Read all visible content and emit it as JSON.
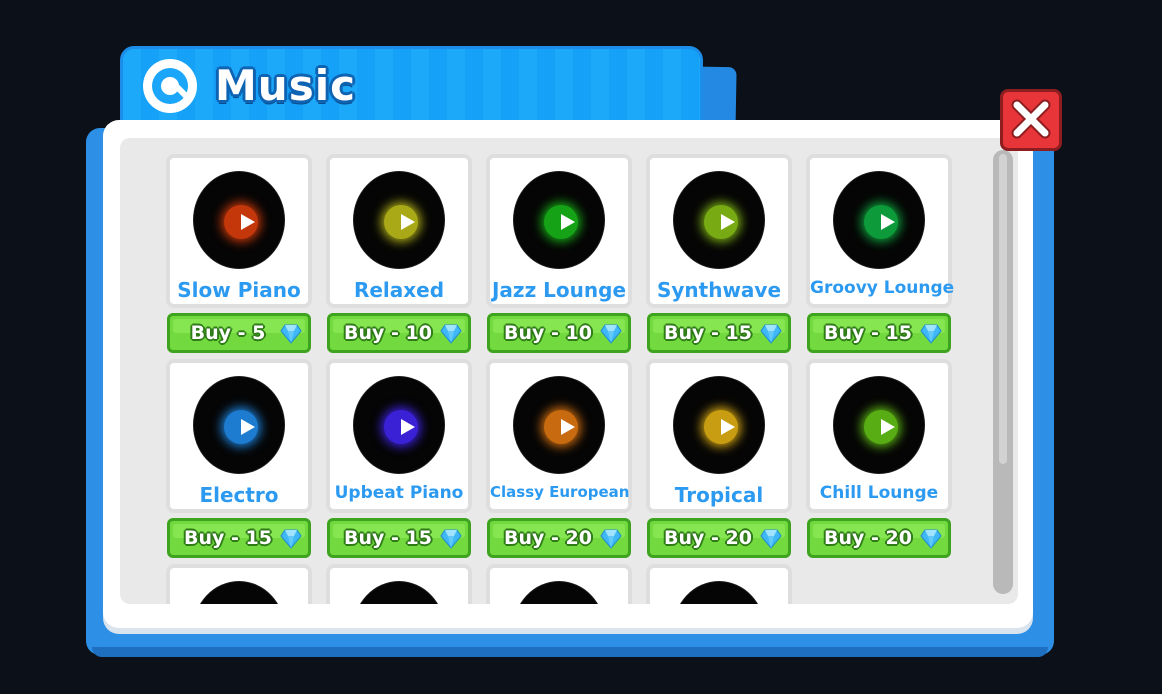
{
  "window": {
    "title": "Music",
    "icon": "music-disc-icon",
    "close_icon": "close-x-icon"
  },
  "colors": {
    "title_bar": "#1da9fa",
    "buy_button": "#72d93e",
    "song_name": "#2b9af0",
    "close_button": "#e7353a"
  },
  "currency_icon": "diamond-gem-icon",
  "songs": [
    {
      "name": "Slow Piano",
      "buy_label": "Buy - 5",
      "disc_color": "#c3370b"
    },
    {
      "name": "Relaxed",
      "buy_label": "Buy - 10",
      "disc_color": "#a9a918"
    },
    {
      "name": "Jazz Lounge",
      "buy_label": "Buy - 10",
      "disc_color": "#16a216"
    },
    {
      "name": "Synthwave",
      "buy_label": "Buy - 15",
      "disc_color": "#78aa14"
    },
    {
      "name": "Groovy Lounge",
      "buy_label": "Buy - 15",
      "disc_color": "#0d9a3a"
    },
    {
      "name": "Electro",
      "buy_label": "Buy - 15",
      "disc_color": "#1d7cd0"
    },
    {
      "name": "Upbeat Piano",
      "buy_label": "Buy - 15",
      "disc_color": "#3b21d6"
    },
    {
      "name": "Classy European",
      "buy_label": "Buy - 20",
      "disc_color": "#c86a10"
    },
    {
      "name": "Tropical",
      "buy_label": "Buy - 20",
      "disc_color": "#c99d12"
    },
    {
      "name": "Chill Lounge",
      "buy_label": "Buy - 20",
      "disc_color": "#58ad14"
    }
  ]
}
